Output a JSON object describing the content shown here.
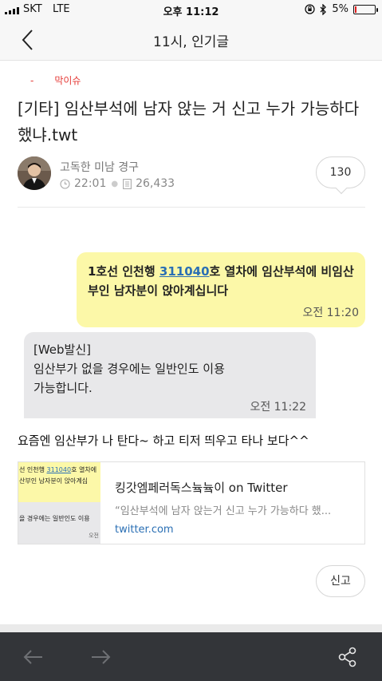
{
  "status_bar": {
    "carrier": "SKT",
    "network": "LTE",
    "time": "오후 11:12",
    "battery_text": "5%",
    "battery_level": 0.05
  },
  "header": {
    "title": "11시, 인기글"
  },
  "post": {
    "category_dash": "-",
    "category": "막이슈",
    "title": "[기타] 임산부석에 남자 앉는 거 신고 누가 가능하다 했냐.twt",
    "author": "고독한 미남 경구",
    "time": "22:01",
    "views": "26,433",
    "comment_count": "130",
    "message_1_prefix": "1호선 인천행 ",
    "message_1_number": "311040",
    "message_1_rest": "호 열차에 임산부석에 비임산부인 남자분이 앉아계십니다",
    "message_1_time": "오전 11:20",
    "message_2_line1": "[Web발신]",
    "message_2_line2": "임산부가 없을 경우에는 일반인도 이용",
    "message_2_line3": "가능합니다.",
    "message_2_time": "오전 11:22",
    "body_text": "요즘엔 임산부가 나 탄다~ 하고 티저 띄우고 타나 보다^^"
  },
  "link_card": {
    "thumb_line1_prefix": "선 인천행 ",
    "thumb_line1_number": "311040",
    "thumb_line1_rest": "호 열차에",
    "thumb_line2": "산부인 남자분이 앉아계십",
    "thumb_line3": "을 경우에는 일반인도 이용",
    "thumb_time": "오전",
    "title": "킹갓엠페러독스늌늌이 on Twitter",
    "description": "“임산부석에 남자 앉는거 신고 누가 가능하다 했...",
    "url": "twitter.com"
  },
  "actions": {
    "report": "신고"
  },
  "icons": {
    "back": "chevron-left-icon",
    "nav_back": "arrow-left-icon",
    "nav_forward": "arrow-right-icon",
    "share": "share-icon"
  },
  "colors": {
    "category": "#e53935",
    "link": "#2a6fb4",
    "toolbar_bg": "#333539",
    "yellow_bubble": "#fcf8a8",
    "gray_bubble": "#e8e8ea"
  }
}
